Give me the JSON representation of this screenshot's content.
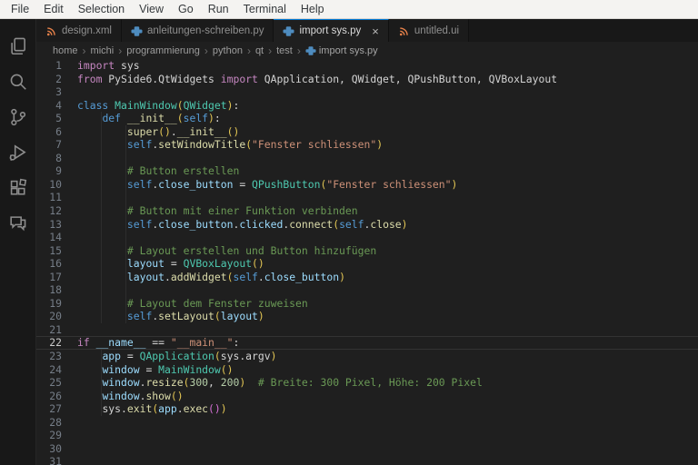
{
  "menubar": {
    "items": [
      "File",
      "Edit",
      "Selection",
      "View",
      "Go",
      "Run",
      "Terminal",
      "Help"
    ]
  },
  "activity_bar": {
    "icons": [
      {
        "name": "explorer-icon",
        "label": "Explorer"
      },
      {
        "name": "search-icon",
        "label": "Search"
      },
      {
        "name": "source-control-icon",
        "label": "Source Control"
      },
      {
        "name": "run-debug-icon",
        "label": "Run and Debug"
      },
      {
        "name": "extensions-icon",
        "label": "Extensions"
      },
      {
        "name": "comments-icon",
        "label": "Comments"
      }
    ]
  },
  "tabs": [
    {
      "label": "design.xml",
      "icon": "xml-icon",
      "active": false
    },
    {
      "label": "anleitungen-schreiben.py",
      "icon": "python-icon",
      "active": false
    },
    {
      "label": "import sys.py",
      "icon": "python-icon",
      "active": true,
      "closable": true
    },
    {
      "label": "untitled.ui",
      "icon": "xml-icon",
      "active": false
    }
  ],
  "icons": {
    "close": "×",
    "breadcrumb_separator": "›"
  },
  "breadcrumbs": {
    "segments": [
      "home",
      "michi",
      "programmierung",
      "python",
      "qt",
      "test"
    ],
    "file": {
      "label": "import sys.py",
      "icon": "python-icon"
    }
  },
  "colors": {
    "accent_tab_border": "#0078d4",
    "editor_bg": "#1f1f1f",
    "activity_bar_bg": "#181818",
    "menubar_bg": "#f4f3f1",
    "keyword": "#C586C0",
    "keyword2": "#569CD6",
    "class": "#4EC9B0",
    "function": "#DCDCAA",
    "variable": "#9CDCFE",
    "string": "#CE9178",
    "number": "#B5CEA8",
    "comment": "#6A9955",
    "default": "#D4D4D4",
    "bracket1": "#E3C654",
    "bracket2": "#D670D6"
  },
  "editor": {
    "active_line": 22,
    "lines": [
      {
        "n": 1,
        "t": [
          [
            "kw",
            "import"
          ],
          [
            "txt",
            " sys"
          ]
        ]
      },
      {
        "n": 2,
        "t": [
          [
            "kw",
            "from"
          ],
          [
            "txt",
            " PySide6.QtWidgets "
          ],
          [
            "kw",
            "import"
          ],
          [
            "txt",
            " QApplication, QWidget, QPushButton, QVBoxLayout"
          ]
        ]
      },
      {
        "n": 3,
        "t": []
      },
      {
        "n": 4,
        "t": [
          [
            "kw2",
            "class"
          ],
          [
            "txt",
            " "
          ],
          [
            "cls",
            "MainWindow"
          ],
          [
            "b1",
            "("
          ],
          [
            "cls",
            "QWidget"
          ],
          [
            "b1",
            ")"
          ],
          [
            "txt",
            ":"
          ]
        ]
      },
      {
        "n": 5,
        "t": [
          [
            "txt",
            "    "
          ],
          [
            "kw2",
            "def"
          ],
          [
            "txt",
            " "
          ],
          [
            "fn",
            "__init__"
          ],
          [
            "b1",
            "("
          ],
          [
            "kw2",
            "self"
          ],
          [
            "b1",
            ")"
          ],
          [
            "txt",
            ":"
          ]
        ]
      },
      {
        "n": 6,
        "t": [
          [
            "txt",
            "        "
          ],
          [
            "fn",
            "super"
          ],
          [
            "b1",
            "()"
          ],
          [
            "txt",
            "."
          ],
          [
            "fn",
            "__init__"
          ],
          [
            "b1",
            "()"
          ]
        ]
      },
      {
        "n": 7,
        "t": [
          [
            "txt",
            "        "
          ],
          [
            "kw2",
            "self"
          ],
          [
            "txt",
            "."
          ],
          [
            "fn",
            "setWindowTitle"
          ],
          [
            "b1",
            "("
          ],
          [
            "str",
            "\"Fenster schliessen\""
          ],
          [
            "b1",
            ")"
          ]
        ]
      },
      {
        "n": 8,
        "t": []
      },
      {
        "n": 9,
        "t": [
          [
            "txt",
            "        "
          ],
          [
            "com",
            "# Button erstellen"
          ]
        ]
      },
      {
        "n": 10,
        "t": [
          [
            "txt",
            "        "
          ],
          [
            "kw2",
            "self"
          ],
          [
            "txt",
            "."
          ],
          [
            "var",
            "close_button"
          ],
          [
            "txt",
            " = "
          ],
          [
            "cls",
            "QPushButton"
          ],
          [
            "b1",
            "("
          ],
          [
            "str",
            "\"Fenster schliessen\""
          ],
          [
            "b1",
            ")"
          ]
        ]
      },
      {
        "n": 11,
        "t": []
      },
      {
        "n": 12,
        "t": [
          [
            "txt",
            "        "
          ],
          [
            "com",
            "# Button mit einer Funktion verbinden"
          ]
        ]
      },
      {
        "n": 13,
        "t": [
          [
            "txt",
            "        "
          ],
          [
            "kw2",
            "self"
          ],
          [
            "txt",
            "."
          ],
          [
            "var",
            "close_button"
          ],
          [
            "txt",
            "."
          ],
          [
            "var",
            "clicked"
          ],
          [
            "txt",
            "."
          ],
          [
            "fn",
            "connect"
          ],
          [
            "b1",
            "("
          ],
          [
            "kw2",
            "self"
          ],
          [
            "txt",
            "."
          ],
          [
            "fn",
            "close"
          ],
          [
            "b1",
            ")"
          ]
        ]
      },
      {
        "n": 14,
        "t": []
      },
      {
        "n": 15,
        "t": [
          [
            "txt",
            "        "
          ],
          [
            "com",
            "# Layout erstellen und Button hinzufügen"
          ]
        ]
      },
      {
        "n": 16,
        "t": [
          [
            "txt",
            "        "
          ],
          [
            "var",
            "layout"
          ],
          [
            "txt",
            " = "
          ],
          [
            "cls",
            "QVBoxLayout"
          ],
          [
            "b1",
            "()"
          ]
        ]
      },
      {
        "n": 17,
        "t": [
          [
            "txt",
            "        "
          ],
          [
            "var",
            "layout"
          ],
          [
            "txt",
            "."
          ],
          [
            "fn",
            "addWidget"
          ],
          [
            "b1",
            "("
          ],
          [
            "kw2",
            "self"
          ],
          [
            "txt",
            "."
          ],
          [
            "var",
            "close_button"
          ],
          [
            "b1",
            ")"
          ]
        ]
      },
      {
        "n": 18,
        "t": []
      },
      {
        "n": 19,
        "t": [
          [
            "txt",
            "        "
          ],
          [
            "com",
            "# Layout dem Fenster zuweisen"
          ]
        ]
      },
      {
        "n": 20,
        "t": [
          [
            "txt",
            "        "
          ],
          [
            "kw2",
            "self"
          ],
          [
            "txt",
            "."
          ],
          [
            "fn",
            "setLayout"
          ],
          [
            "b1",
            "("
          ],
          [
            "var",
            "layout"
          ],
          [
            "b1",
            ")"
          ]
        ]
      },
      {
        "n": 21,
        "t": []
      },
      {
        "n": 22,
        "t": [
          [
            "kw",
            "if"
          ],
          [
            "txt",
            " "
          ],
          [
            "var",
            "__name__"
          ],
          [
            "txt",
            " == "
          ],
          [
            "str",
            "\"__main__\""
          ],
          [
            "txt",
            ":"
          ]
        ]
      },
      {
        "n": 23,
        "t": [
          [
            "txt",
            "    "
          ],
          [
            "var",
            "app"
          ],
          [
            "txt",
            " = "
          ],
          [
            "cls",
            "QApplication"
          ],
          [
            "b1",
            "("
          ],
          [
            "txt",
            "sys.argv"
          ],
          [
            "b1",
            ")"
          ]
        ]
      },
      {
        "n": 24,
        "t": [
          [
            "txt",
            "    "
          ],
          [
            "var",
            "window"
          ],
          [
            "txt",
            " = "
          ],
          [
            "cls",
            "MainWindow"
          ],
          [
            "b1",
            "()"
          ]
        ]
      },
      {
        "n": 25,
        "t": [
          [
            "txt",
            "    "
          ],
          [
            "var",
            "window"
          ],
          [
            "txt",
            "."
          ],
          [
            "fn",
            "resize"
          ],
          [
            "b1",
            "("
          ],
          [
            "num",
            "300"
          ],
          [
            "txt",
            ", "
          ],
          [
            "num",
            "200"
          ],
          [
            "b1",
            ")"
          ],
          [
            "txt",
            "  "
          ],
          [
            "com",
            "# Breite: 300 Pixel, Höhe: 200 Pixel"
          ]
        ]
      },
      {
        "n": 26,
        "t": [
          [
            "txt",
            "    "
          ],
          [
            "var",
            "window"
          ],
          [
            "txt",
            "."
          ],
          [
            "fn",
            "show"
          ],
          [
            "b1",
            "()"
          ]
        ]
      },
      {
        "n": 27,
        "t": [
          [
            "txt",
            "    "
          ],
          [
            "txt",
            "sys"
          ],
          [
            "txt",
            "."
          ],
          [
            "fn",
            "exit"
          ],
          [
            "b1",
            "("
          ],
          [
            "var",
            "app"
          ],
          [
            "txt",
            "."
          ],
          [
            "fn",
            "exec"
          ],
          [
            "b2",
            "()"
          ],
          [
            "b1",
            ")"
          ]
        ]
      },
      {
        "n": 28,
        "t": []
      },
      {
        "n": 29,
        "t": []
      },
      {
        "n": 30,
        "t": []
      },
      {
        "n": 31,
        "t": []
      }
    ]
  }
}
